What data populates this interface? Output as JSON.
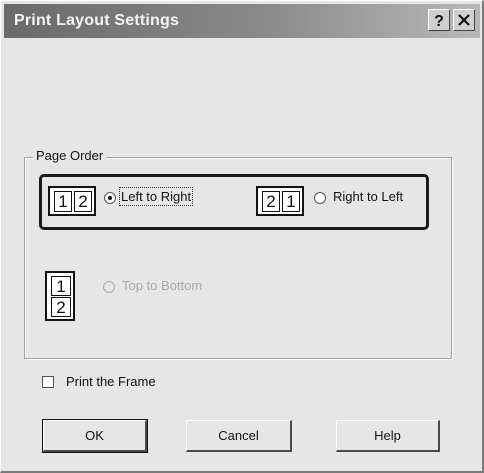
{
  "window": {
    "title": "Print Layout Settings",
    "help_button_glyph": "?",
    "close_button_glyph": "✕"
  },
  "page_order": {
    "group_label": "Page Order",
    "options": [
      {
        "label": "Left to Right",
        "checked": true,
        "enabled": true,
        "focused": true,
        "icon": "page-order-left-to-right-icon",
        "icon_cells": [
          "1",
          "2"
        ]
      },
      {
        "label": "Right to Left",
        "checked": false,
        "enabled": true,
        "focused": false,
        "icon": "page-order-right-to-left-icon",
        "icon_cells": [
          "2",
          "1"
        ]
      },
      {
        "label": "Top to Bottom",
        "checked": false,
        "enabled": false,
        "focused": false,
        "icon": "page-order-top-to-bottom-icon",
        "icon_cells": [
          "1",
          "2"
        ]
      }
    ]
  },
  "print_frame": {
    "label": "Print the Frame",
    "checked": false
  },
  "buttons": {
    "ok": "OK",
    "cancel": "Cancel",
    "help": "Help"
  }
}
